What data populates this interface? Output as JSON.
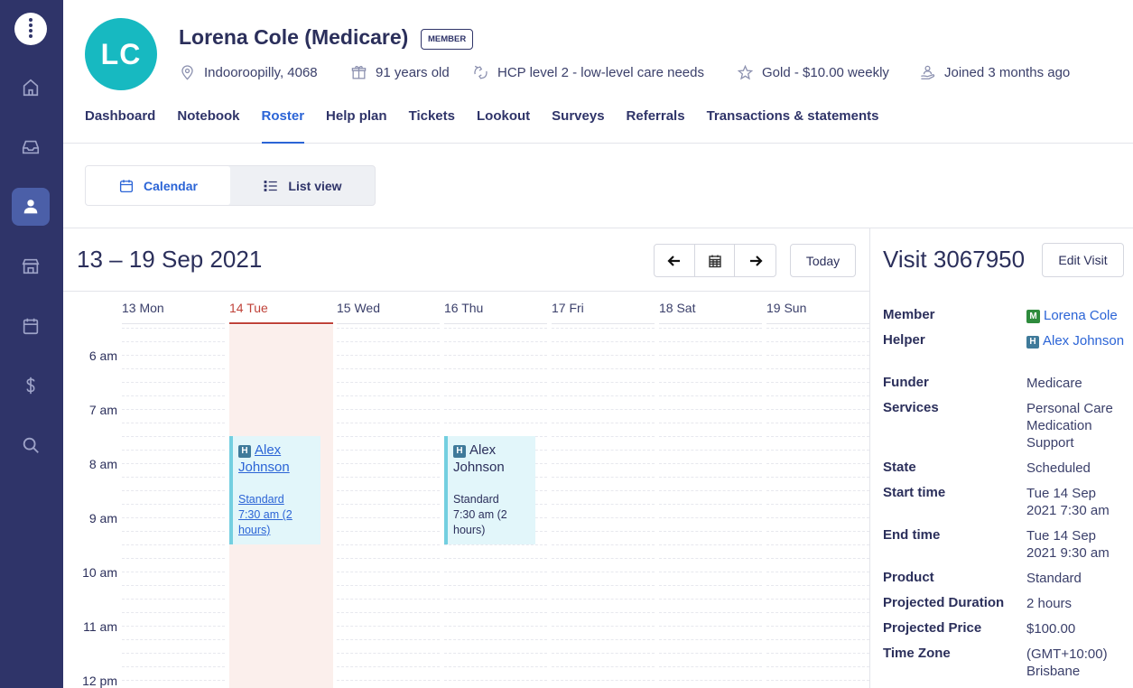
{
  "member": {
    "initials": "LC",
    "name": "Lorena Cole (Medicare)",
    "badge": "MEMBER",
    "location": "Indooroopilly, 4068",
    "age": "91 years old",
    "care_level": "HCP level 2 - low-level care needs",
    "plan": "Gold - $10.00 weekly",
    "joined": "Joined 3 months ago"
  },
  "tabs": [
    "Dashboard",
    "Notebook",
    "Roster",
    "Help plan",
    "Tickets",
    "Lookout",
    "Surveys",
    "Referrals",
    "Transactions & statements"
  ],
  "active_tab": "Roster",
  "view_toggle": {
    "calendar": "Calendar",
    "list": "List view",
    "active": "Calendar"
  },
  "calendar": {
    "range_title": "13 – 19 Sep 2021",
    "today_label": "Today",
    "days": [
      "13 Mon",
      "14 Tue",
      "15 Wed",
      "16 Thu",
      "17 Fri",
      "18 Sat",
      "19 Sun"
    ],
    "today": "14 Tue",
    "hours": [
      "6 am",
      "7 am",
      "8 am",
      "9 am",
      "10 am",
      "11 am",
      "12 pm"
    ],
    "events": [
      {
        "day": "14 Tue",
        "badge": "H",
        "helper": "Alex Johnson",
        "product": "Standard",
        "time": "7:30 am (2 hours)",
        "selected": true
      },
      {
        "day": "16 Thu",
        "badge": "H",
        "helper": "Alex Johnson",
        "product": "Standard",
        "time": "7:30 am (2 hours)",
        "selected": false
      }
    ]
  },
  "visit": {
    "title": "Visit 3067950",
    "edit_label": "Edit Visit",
    "member_label": "Member",
    "member_badge": "M",
    "member_value": "Lorena Cole",
    "helper_label": "Helper",
    "helper_badge": "H",
    "helper_value": "Alex Johnson",
    "funder_label": "Funder",
    "funder_value": "Medicare",
    "services_label": "Services",
    "services_value": [
      "Personal Care",
      "Medication Support"
    ],
    "state_label": "State",
    "state_value": "Scheduled",
    "start_label": "Start time",
    "start_value": "Tue 14 Sep 2021 7:30 am",
    "end_label": "End time",
    "end_value": "Tue 14 Sep 2021 9:30 am",
    "product_label": "Product",
    "product_value": "Standard",
    "duration_label": "Projected Duration",
    "duration_value": "2 hours",
    "price_label": "Projected Price",
    "price_value": "$100.00",
    "tz_label": "Time Zone",
    "tz_value": "(GMT+10:00) Brisbane"
  },
  "icons": [
    "logo-icon",
    "home-icon",
    "inbox-icon",
    "person-icon",
    "store-icon",
    "calendar-icon",
    "dollar-icon",
    "search-icon"
  ]
}
